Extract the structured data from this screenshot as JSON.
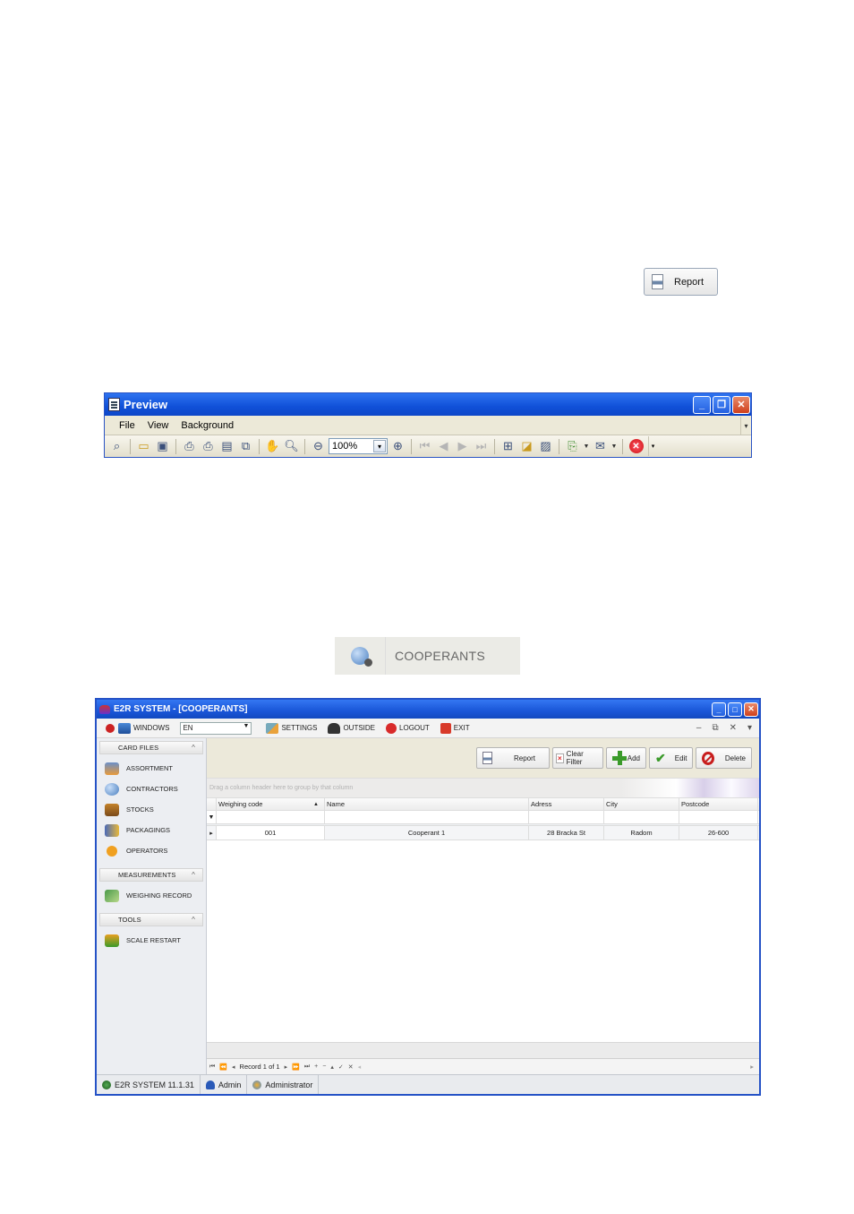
{
  "report_snippet": {
    "label": "Report"
  },
  "preview": {
    "title": "Preview",
    "menu": [
      "File",
      "View",
      "Background"
    ],
    "zoom": "100%"
  },
  "cooperants_snippet": {
    "label": "COOPERANTS"
  },
  "app": {
    "title": "E2R SYSTEM - [COOPERANTS]",
    "toolbar": {
      "windows": "WINDOWS",
      "language": "EN",
      "settings": "SETTINGS",
      "outside": "OUTSIDE",
      "logout": "LOGOUT",
      "exit": "EXIT"
    },
    "sidebar": {
      "groups": [
        {
          "title": "CARD FILES",
          "items": [
            "ASSORTMENT",
            "CONTRACTORS",
            "STOCKS",
            "PACKAGINGS",
            "OPERATORS"
          ]
        },
        {
          "title": "MEASUREMENTS",
          "items": [
            "WEIGHING RECORD"
          ]
        },
        {
          "title": "TOOLS",
          "items": [
            "SCALE RESTART"
          ]
        }
      ]
    },
    "main_toolbar": {
      "report": "Report",
      "clear_filter": "Clear Filter",
      "add": "Add",
      "edit": "Edit",
      "delete": "Delete"
    },
    "group_panel_hint": "Drag a column header here to group by that column",
    "grid": {
      "columns": [
        "Weighing code",
        "Name",
        "Adress",
        "City",
        "Postcode"
      ],
      "rows": [
        [
          "001",
          "Cooperant 1",
          "28 Bracka St",
          "Radom",
          "26-600"
        ]
      ]
    },
    "navigator": {
      "record_text": "Record 1 of 1"
    },
    "status": {
      "version": "E2R SYSTEM 11.1.31",
      "user": "Admin",
      "role": "Administrator"
    }
  },
  "colors": {
    "xp_title_blue": "#1a56d8",
    "accent_green": "#3a9a2a",
    "delete_red": "#c81e1e"
  }
}
